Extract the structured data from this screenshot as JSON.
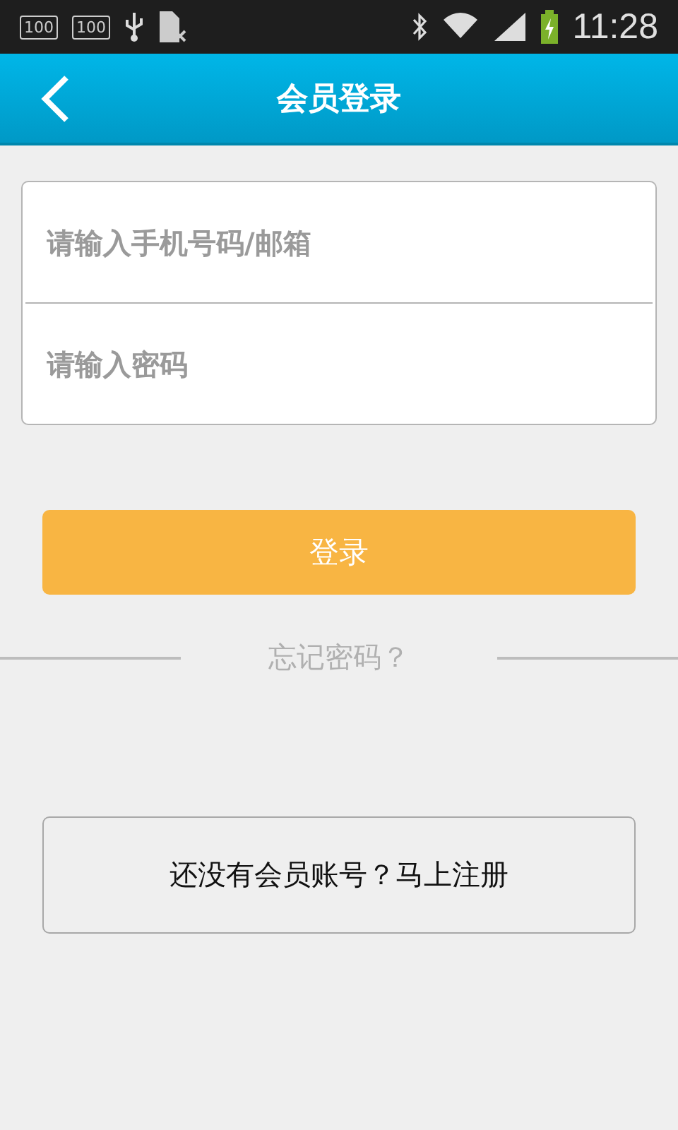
{
  "status_bar": {
    "left_badges": [
      "100",
      "100"
    ],
    "time": "11:28"
  },
  "header": {
    "title": "会员登录"
  },
  "form": {
    "fields": [
      {
        "placeholder": "请输入手机号码/邮箱"
      },
      {
        "placeholder": "请输入密码"
      }
    ]
  },
  "login_button": "登录",
  "forgot_password": "忘记密码？",
  "register_button": "还没有会员账号？马上注册"
}
